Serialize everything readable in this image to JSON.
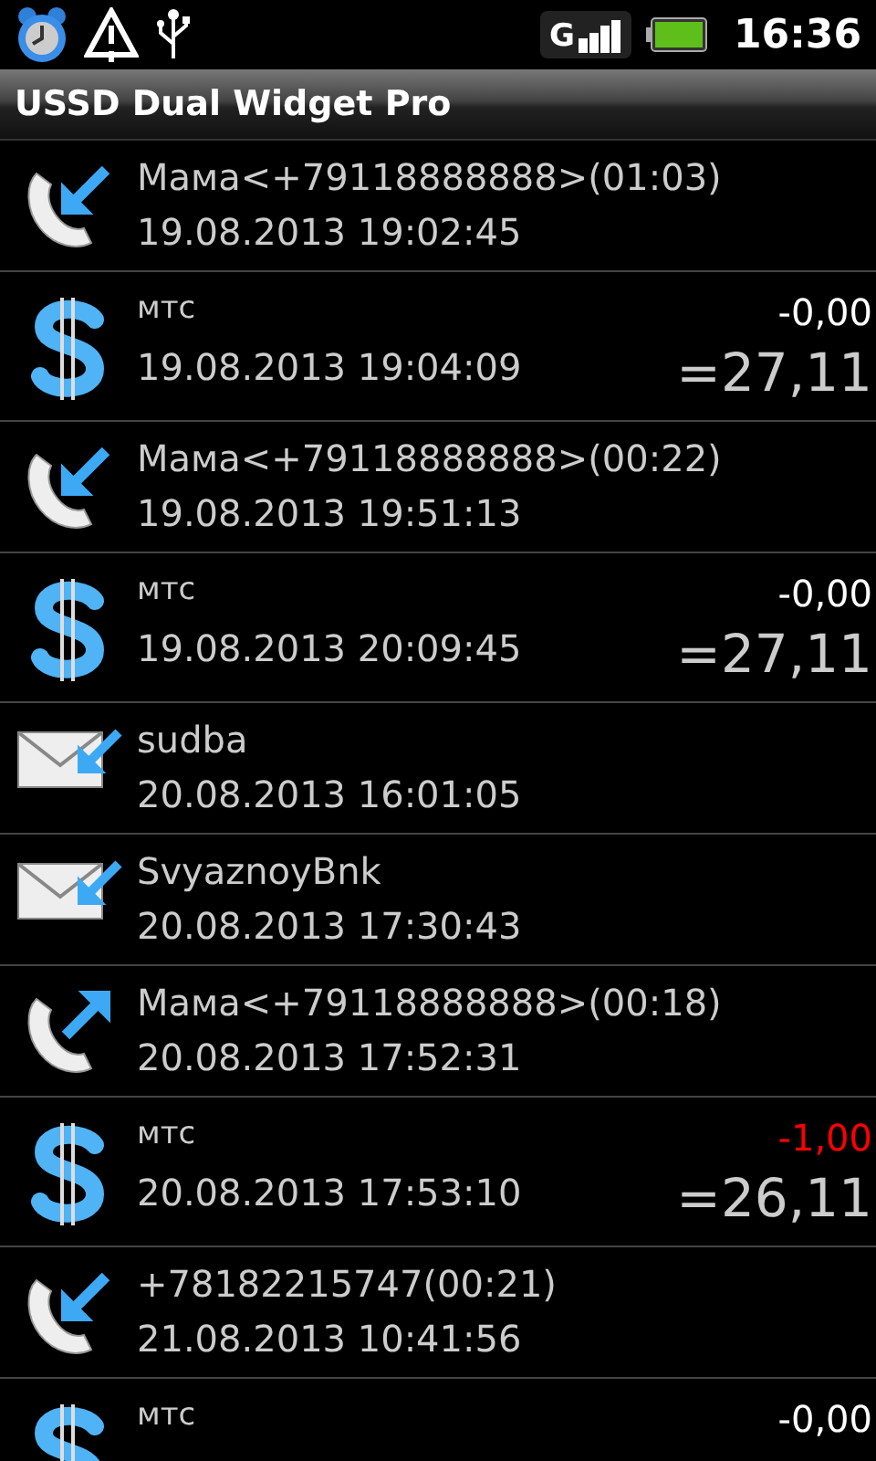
{
  "status_bar": {
    "time": "16:36",
    "network": "G"
  },
  "title_bar": {
    "title": "USSD Dual Widget Pro"
  },
  "log": [
    {
      "kind": "call_in",
      "title": "Мама<+79118888888>(01:03)",
      "date": "19.08.2013 19:02:45"
    },
    {
      "kind": "money",
      "title": "мтс",
      "date": "19.08.2013 19:04:09",
      "change": "-0,00",
      "color": "#ffffff",
      "balance": "=27,11"
    },
    {
      "kind": "call_in",
      "title": "Мама<+79118888888>(00:22)",
      "date": "19.08.2013 19:51:13"
    },
    {
      "kind": "money",
      "title": "мтс",
      "date": "19.08.2013 20:09:45",
      "change": "-0,00",
      "color": "#ffffff",
      "balance": "=27,11"
    },
    {
      "kind": "sms",
      "title": "sudba",
      "date": "20.08.2013 16:01:05"
    },
    {
      "kind": "sms",
      "title": "SvyaznoyBnk",
      "date": "20.08.2013 17:30:43"
    },
    {
      "kind": "call_out",
      "title": "Мама<+79118888888>(00:18)",
      "date": "20.08.2013 17:52:31"
    },
    {
      "kind": "money",
      "title": "мтс",
      "date": "20.08.2013 17:53:10",
      "change": "-1,00",
      "color": "#ff0000",
      "balance": "=26,11"
    },
    {
      "kind": "call_in",
      "title": "+78182215747(00:21)",
      "date": "21.08.2013 10:41:56"
    },
    {
      "kind": "money",
      "title": "мтс",
      "change": "-0,00",
      "color": "#ffffff"
    }
  ]
}
